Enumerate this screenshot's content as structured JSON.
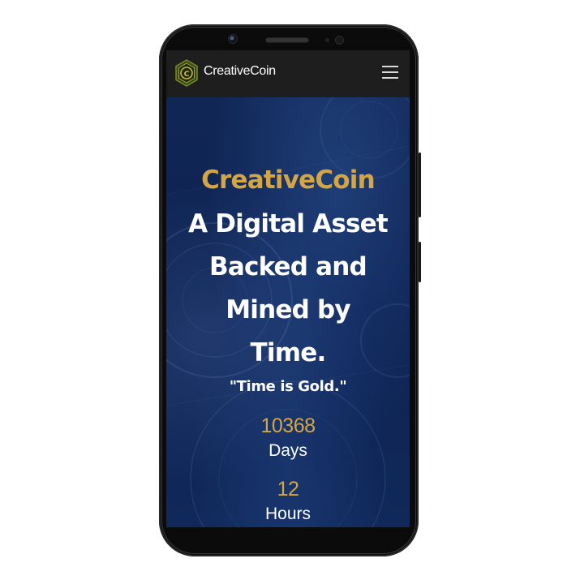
{
  "navbar": {
    "brand": "CreativeCoin",
    "logo_letter": "C",
    "menu_icon": "hamburger-menu-icon"
  },
  "hero": {
    "brand": "CreativeCoin",
    "heading": "A Digital Asset Backed and Mined by Time.",
    "tagline": "\"Time is Gold.\""
  },
  "countdown": {
    "days_value": "10368",
    "days_label": "Days",
    "hours_value": "12",
    "hours_label": "Hours"
  },
  "colors": {
    "accent_gold": "#d4a545",
    "navbar_bg": "#1e1e1e",
    "hero_bg": "#0f2550",
    "text_white": "#ffffff"
  }
}
